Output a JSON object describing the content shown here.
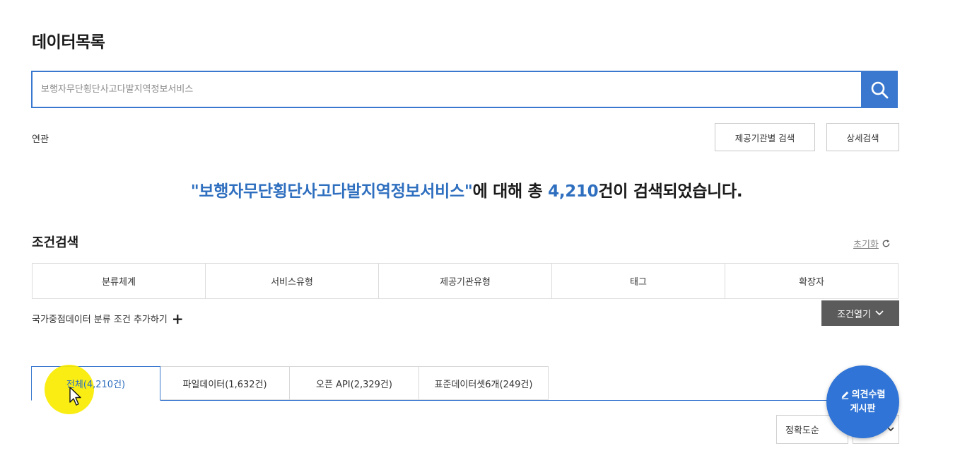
{
  "page": {
    "title": "데이터목록"
  },
  "search": {
    "placeholder": "보행자무단횡단사고다발지역정보서비스",
    "button_icon": "search-icon"
  },
  "related": {
    "label": "연관"
  },
  "buttons": {
    "org_search": "제공기관별 검색",
    "detail_search": "상세검색",
    "open_conditions": "조건열기"
  },
  "result": {
    "query_quoted": "\"보행자무단횡단사고다발지역정보서비스\"",
    "mid_text": "에 대해 총 ",
    "count": "4,210",
    "tail_text": "건이 검색되었습니다."
  },
  "conditions": {
    "title": "조건검색",
    "reset_label": "초기화",
    "columns": [
      "분류체계",
      "서비스유형",
      "제공기관유형",
      "태그",
      "확장자"
    ],
    "add_label": "국가중점데이터 분류 조건 추가하기"
  },
  "tabs": [
    {
      "label": "전체(4,210건)",
      "active": true
    },
    {
      "label": "파일데이터(1,632건)",
      "active": false
    },
    {
      "label": "오픈 API(2,329건)",
      "active": false
    },
    {
      "label": "표준데이터셋6개(249건)",
      "active": false
    }
  ],
  "sort": {
    "selected": "정확도순"
  },
  "feedback": {
    "line1": "의견수렴",
    "line2": "게시판"
  },
  "colors": {
    "accent": "#3a78cf",
    "highlight_text": "#2f6fbf",
    "fab": "#2f74d6",
    "dark_button": "#5b5b5b",
    "cursor_highlight": "#f8ec00"
  }
}
